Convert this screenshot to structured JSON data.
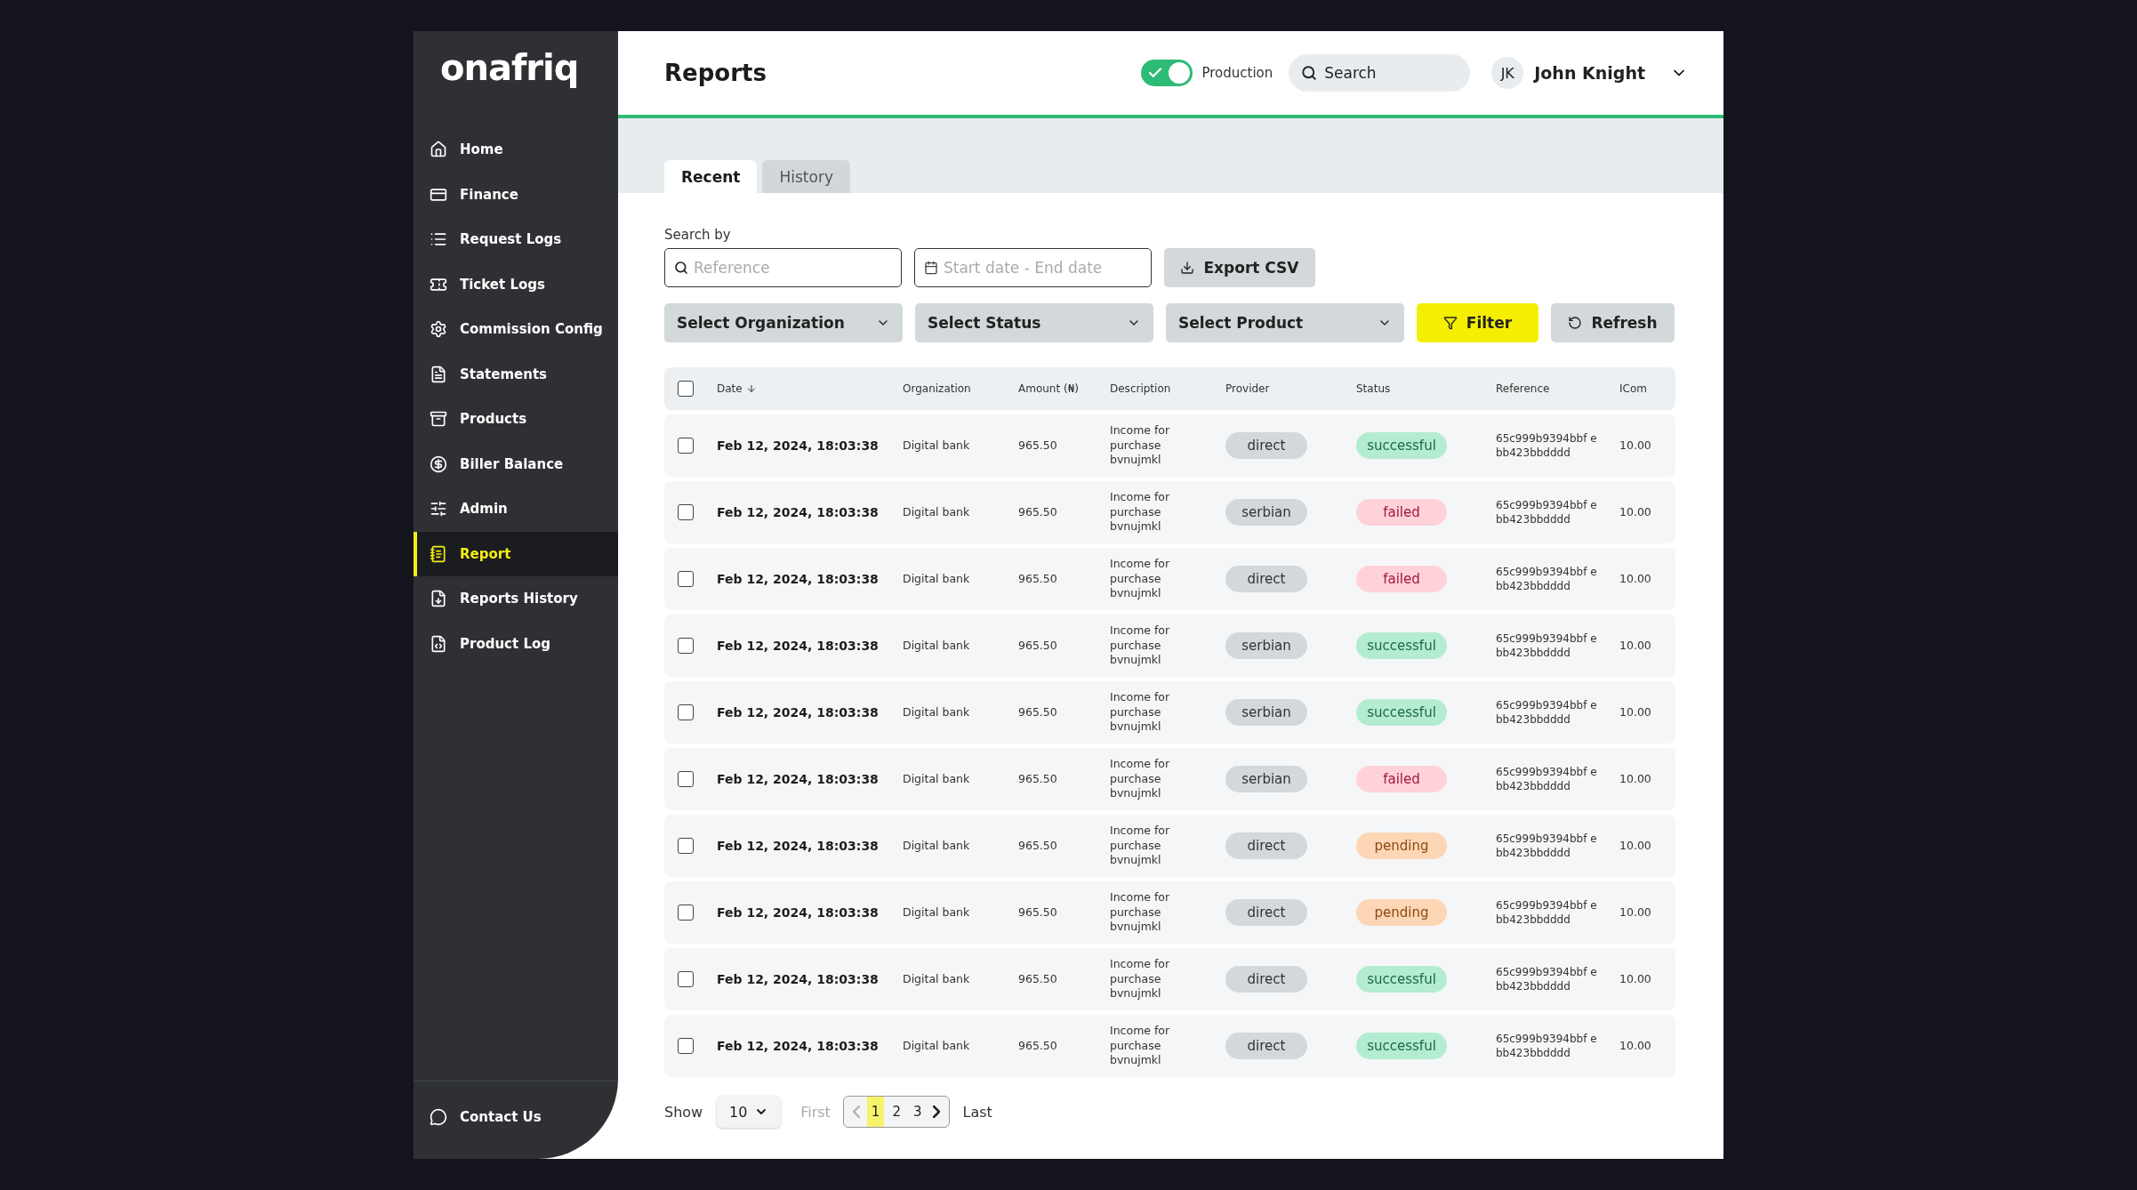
{
  "sidebar": {
    "logo": "onafriq",
    "items": [
      {
        "label": "Home",
        "selected": false
      },
      {
        "label": "Finance",
        "selected": false
      },
      {
        "label": "Request Logs",
        "selected": false
      },
      {
        "label": "Ticket Logs",
        "selected": false
      },
      {
        "label": "Commission Config",
        "selected": false
      },
      {
        "label": "Statements",
        "selected": false
      },
      {
        "label": "Products",
        "selected": false
      },
      {
        "label": "Biller Balance",
        "selected": false
      },
      {
        "label": "Admin",
        "selected": false
      },
      {
        "label": "Report",
        "selected": true
      },
      {
        "label": "Reports History",
        "selected": false
      },
      {
        "label": "Product Log",
        "selected": false
      }
    ],
    "footer": {
      "label": "Contact Us"
    }
  },
  "header": {
    "title": "Reports",
    "environment": {
      "label": "Production",
      "on": true
    },
    "search": {
      "placeholder": "Search"
    },
    "user": {
      "initials": "JK",
      "name": "John Knight"
    }
  },
  "tabs": [
    {
      "label": "Recent",
      "selected": true
    },
    {
      "label": "History",
      "selected": false
    }
  ],
  "filters": {
    "search_label": "Search by",
    "reference": {
      "placeholder": "Reference"
    },
    "date_range": {
      "placeholder": "Start date - End date"
    },
    "export_button": "Export CSV",
    "selects": [
      {
        "label": "Select Organization"
      },
      {
        "label": "Select Status"
      },
      {
        "label": "Select Product"
      }
    ],
    "filter_button": "Filter",
    "refresh_button": "Refresh"
  },
  "table": {
    "select_all": {
      "checked": false
    },
    "columns": [
      "Date",
      "Organization",
      "Amount (₦)",
      "Description",
      "Provider",
      "Status",
      "Reference",
      "ICom"
    ],
    "rows": [
      {
        "checked": false,
        "date": "Feb 12, 2024, 18:03:38",
        "organization": "Digital bank",
        "amount": "965.50",
        "description": "Income for purchase bvnujmkl",
        "provider": "direct",
        "status": {
          "text": "successful",
          "kind": "success"
        },
        "reference": "65c999b9394bbf ebb423bbdddd",
        "icom": "10.00"
      },
      {
        "checked": false,
        "date": "Feb 12, 2024, 18:03:38",
        "organization": "Digital bank",
        "amount": "965.50",
        "description": "Income for purchase bvnujmkl",
        "provider": "serbian",
        "status": {
          "text": "failed",
          "kind": "failed"
        },
        "reference": "65c999b9394bbf ebb423bbdddd",
        "icom": "10.00"
      },
      {
        "checked": false,
        "date": "Feb 12, 2024, 18:03:38",
        "organization": "Digital bank",
        "amount": "965.50",
        "description": "Income for purchase bvnujmkl",
        "provider": "direct",
        "status": {
          "text": "failed",
          "kind": "failed"
        },
        "reference": "65c999b9394bbf ebb423bbdddd",
        "icom": "10.00"
      },
      {
        "checked": false,
        "date": "Feb 12, 2024, 18:03:38",
        "organization": "Digital bank",
        "amount": "965.50",
        "description": "Income for purchase bvnujmkl",
        "provider": "serbian",
        "status": {
          "text": "successful",
          "kind": "success"
        },
        "reference": "65c999b9394bbf ebb423bbdddd",
        "icom": "10.00"
      },
      {
        "checked": false,
        "date": "Feb 12, 2024, 18:03:38",
        "organization": "Digital bank",
        "amount": "965.50",
        "description": "Income for purchase bvnujmkl",
        "provider": "serbian",
        "status": {
          "text": "successful",
          "kind": "success"
        },
        "reference": "65c999b9394bbf ebb423bbdddd",
        "icom": "10.00"
      },
      {
        "checked": false,
        "date": "Feb 12, 2024, 18:03:38",
        "organization": "Digital bank",
        "amount": "965.50",
        "description": "Income for purchase bvnujmkl",
        "provider": "serbian",
        "status": {
          "text": "failed",
          "kind": "failed"
        },
        "reference": "65c999b9394bbf ebb423bbdddd",
        "icom": "10.00"
      },
      {
        "checked": false,
        "date": "Feb 12, 2024, 18:03:38",
        "organization": "Digital bank",
        "amount": "965.50",
        "description": "Income for purchase bvnujmkl",
        "provider": "direct",
        "status": {
          "text": "pending",
          "kind": "pending"
        },
        "reference": "65c999b9394bbf ebb423bbdddd",
        "icom": "10.00"
      },
      {
        "checked": false,
        "date": "Feb 12, 2024, 18:03:38",
        "organization": "Digital bank",
        "amount": "965.50",
        "description": "Income for purchase bvnujmkl",
        "provider": "direct",
        "status": {
          "text": "pending",
          "kind": "pending"
        },
        "reference": "65c999b9394bbf ebb423bbdddd",
        "icom": "10.00"
      },
      {
        "checked": false,
        "date": "Feb 12, 2024, 18:03:38",
        "organization": "Digital bank",
        "amount": "965.50",
        "description": "Income for purchase bvnujmkl",
        "provider": "direct",
        "status": {
          "text": "successful",
          "kind": "success"
        },
        "reference": "65c999b9394bbf ebb423bbdddd",
        "icom": "10.00"
      },
      {
        "checked": false,
        "date": "Feb 12, 2024, 18:03:38",
        "organization": "Digital bank",
        "amount": "965.50",
        "description": "Income for purchase bvnujmkl",
        "provider": "direct",
        "status": {
          "text": "successful",
          "kind": "success"
        },
        "reference": "65c999b9394bbf ebb423bbdddd",
        "icom": "10.00"
      }
    ]
  },
  "pagination": {
    "show_label": "Show",
    "page_size": "10",
    "first": "First",
    "pages": [
      {
        "label": "1",
        "selected": true
      },
      {
        "label": "2",
        "selected": false
      },
      {
        "label": "3",
        "selected": false
      }
    ],
    "last": "Last"
  }
}
